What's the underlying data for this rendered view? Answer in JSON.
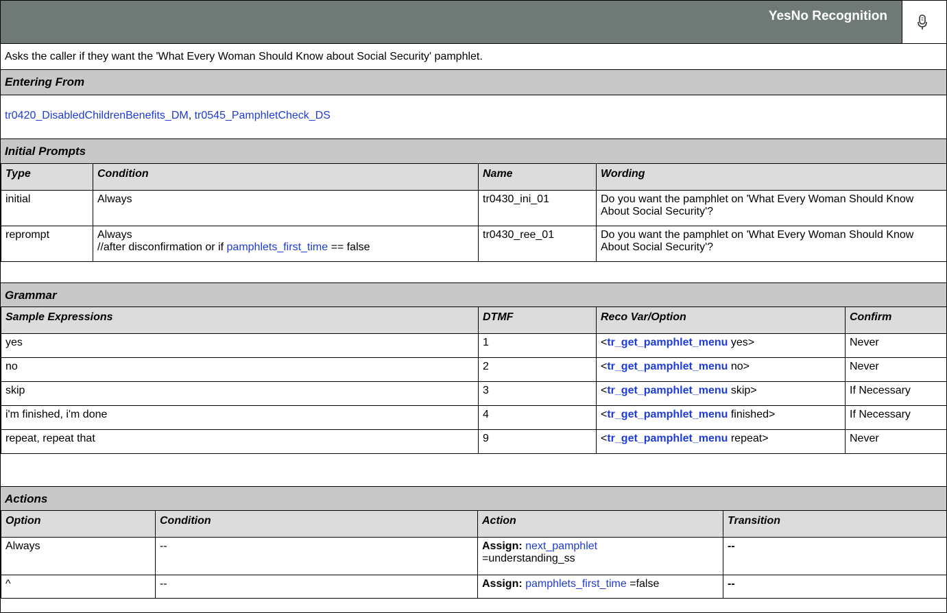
{
  "header": {
    "title": "YesNo Recognition",
    "mic_icon": "microphone-icon"
  },
  "description": "Asks the caller if they want the 'What Every Woman Should Know about Social Security' pamphlet.",
  "entering_from": {
    "heading": "Entering From",
    "links": [
      "tr0420_DisabledChildrenBenefits_DM",
      "tr0545_PamphletCheck_DS"
    ],
    "separator": ", "
  },
  "initial_prompts": {
    "heading": "Initial Prompts",
    "columns": [
      "Type",
      "Condition",
      "Name",
      "Wording"
    ],
    "rows": [
      {
        "type": "initial",
        "condition_line1": "Always",
        "condition_line2_pre": "",
        "condition_link": "",
        "condition_line2_post": "",
        "name": "tr0430_ini_01",
        "wording": "Do you want the pamphlet on 'What Every Woman Should Know About Social Security'?"
      },
      {
        "type": "reprompt",
        "condition_line1": "Always",
        "condition_line2_pre": "//after disconfirmation or if ",
        "condition_link": "pamphlets_first_time",
        "condition_line2_post": " == false",
        "name": "tr0430_ree_01",
        "wording": "Do you want the pamphlet on 'What Every Woman Should Know About Social Security'?"
      }
    ]
  },
  "grammar": {
    "heading": "Grammar",
    "columns": [
      "Sample Expressions",
      "DTMF",
      "Reco Var/Option",
      "Confirm"
    ],
    "grammar_link": "tr_get_pamphlet_menu",
    "rows": [
      {
        "expr": "yes",
        "dtmf": "1",
        "opt": "yes>",
        "confirm": "Never"
      },
      {
        "expr": "no",
        "dtmf": "2",
        "opt": "no>",
        "confirm": "Never"
      },
      {
        "expr": "skip",
        "dtmf": "3",
        "opt": "skip>",
        "confirm": "If Necessary"
      },
      {
        "expr": "i'm finished, i'm done",
        "dtmf": "4",
        "opt": "finished>",
        "confirm": "If Necessary"
      },
      {
        "expr": "repeat, repeat that",
        "dtmf": "9",
        "opt": "repeat>",
        "confirm": "Never"
      }
    ]
  },
  "actions": {
    "heading": "Actions",
    "columns": [
      "Option",
      "Condition",
      "Action",
      "Transition"
    ],
    "rows": [
      {
        "option": "Always",
        "condition": "--",
        "assign_label": "Assign:",
        "assign_link": "next_pamphlet",
        "assign_rest": "=understanding_ss",
        "transition": "--"
      },
      {
        "option": "^",
        "condition": "--",
        "assign_label": "Assign:",
        "assign_link": "pamphlets_first_time",
        "assign_rest": " =false",
        "transition": "--"
      }
    ]
  }
}
